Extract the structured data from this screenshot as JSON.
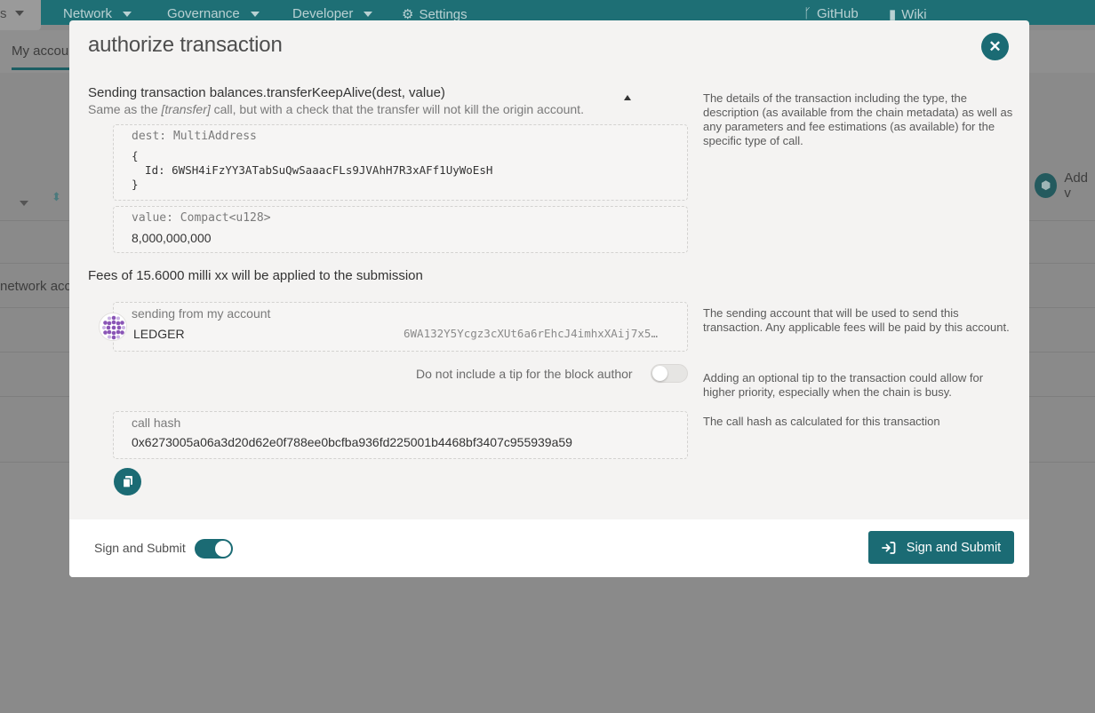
{
  "background": {
    "first_tab_label": "s",
    "menu": [
      {
        "label": "Network"
      },
      {
        "label": "Governance"
      },
      {
        "label": "Developer"
      },
      {
        "label": "Settings"
      }
    ],
    "links": {
      "github": "GitHub",
      "wiki": "Wiki"
    },
    "subtab": "My accoun",
    "row_text": "network acco",
    "add_button": "Add v"
  },
  "modal": {
    "title": "authorize transaction",
    "close_icon": "close-icon",
    "transaction": {
      "heading": "Sending transaction balances.transferKeepAlive(dest, value)",
      "desc_prefix": "Same as the ",
      "desc_code": "[transfer]",
      "desc_suffix": " call, but with a check that the transfer will not kill the origin account."
    },
    "params": {
      "dest_label": "dest: MultiAddress",
      "dest_open": "{",
      "dest_id": "  Id: 6WSH4iFzYY3ATabSuQwSaaacFLs9JVAhH7R3xAFf1UyWoEsH",
      "dest_close": "}",
      "value_label": "value: Compact<u128>",
      "value": "8,000,000,000"
    },
    "fees": "Fees of 15.6000 milli xx will be applied to the submission",
    "account": {
      "label": "sending from my account",
      "name": "LEDGER",
      "address": "6WA132Y5Ycgz3cXUt6a6rEhcJ4imhxXAij7x5…"
    },
    "tip": {
      "label": "Do not include a tip for the block author",
      "enabled": false
    },
    "call_hash": {
      "label": "call hash",
      "value": "0x6273005a06a3d20d62e0f788ee0bcfba936fd225001b4468bf3407c955939a59"
    },
    "help": {
      "details": "The details of the transaction including the type, the description (as available from the chain metadata) as well as any parameters and fee estimations (as available) for the specific type of call.",
      "account": "The sending account that will be used to send this transaction. Any applicable fees will be paid by this account.",
      "tip": "Adding an optional tip to the transaction could allow for higher priority, especially when the chain is busy.",
      "hash": "The call hash as calculated for this transaction"
    },
    "footer": {
      "toggle_label": "Sign and Submit",
      "toggle_on": true,
      "submit_label": "Sign and Submit"
    }
  },
  "colors": {
    "accent": "#1b6b74",
    "overlay": "#8a8a8a"
  }
}
